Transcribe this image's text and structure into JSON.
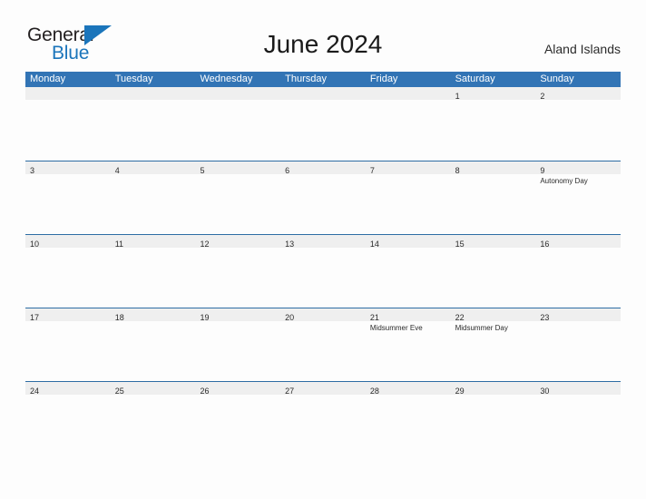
{
  "brand": {
    "name_part1": "General",
    "name_part2": "Blue",
    "flag_icon": "blue-flag-triangle-icon",
    "accent_color": "#1b75bb"
  },
  "header": {
    "title": "June 2024",
    "region": "Aland Islands"
  },
  "theme": {
    "header_blue": "#3274b5",
    "row_border_blue": "#2e6da4",
    "date_band_gray": "#efefef",
    "page_background": "#fdfdfd",
    "text_color": "#2b2b2b"
  },
  "calendar": {
    "month": "June",
    "year": "2024",
    "weekday_headers": [
      "Monday",
      "Tuesday",
      "Wednesday",
      "Thursday",
      "Friday",
      "Saturday",
      "Sunday"
    ],
    "weeks": [
      [
        {
          "date": "",
          "events": []
        },
        {
          "date": "",
          "events": []
        },
        {
          "date": "",
          "events": []
        },
        {
          "date": "",
          "events": []
        },
        {
          "date": "",
          "events": []
        },
        {
          "date": "1",
          "events": []
        },
        {
          "date": "2",
          "events": []
        }
      ],
      [
        {
          "date": "3",
          "events": []
        },
        {
          "date": "4",
          "events": []
        },
        {
          "date": "5",
          "events": []
        },
        {
          "date": "6",
          "events": []
        },
        {
          "date": "7",
          "events": []
        },
        {
          "date": "8",
          "events": []
        },
        {
          "date": "9",
          "events": [
            "Autonomy Day"
          ]
        }
      ],
      [
        {
          "date": "10",
          "events": []
        },
        {
          "date": "11",
          "events": []
        },
        {
          "date": "12",
          "events": []
        },
        {
          "date": "13",
          "events": []
        },
        {
          "date": "14",
          "events": []
        },
        {
          "date": "15",
          "events": []
        },
        {
          "date": "16",
          "events": []
        }
      ],
      [
        {
          "date": "17",
          "events": []
        },
        {
          "date": "18",
          "events": []
        },
        {
          "date": "19",
          "events": []
        },
        {
          "date": "20",
          "events": []
        },
        {
          "date": "21",
          "events": [
            "Midsummer Eve"
          ]
        },
        {
          "date": "22",
          "events": [
            "Midsummer Day"
          ]
        },
        {
          "date": "23",
          "events": []
        }
      ],
      [
        {
          "date": "24",
          "events": []
        },
        {
          "date": "25",
          "events": []
        },
        {
          "date": "26",
          "events": []
        },
        {
          "date": "27",
          "events": []
        },
        {
          "date": "28",
          "events": []
        },
        {
          "date": "29",
          "events": []
        },
        {
          "date": "30",
          "events": []
        }
      ]
    ]
  }
}
